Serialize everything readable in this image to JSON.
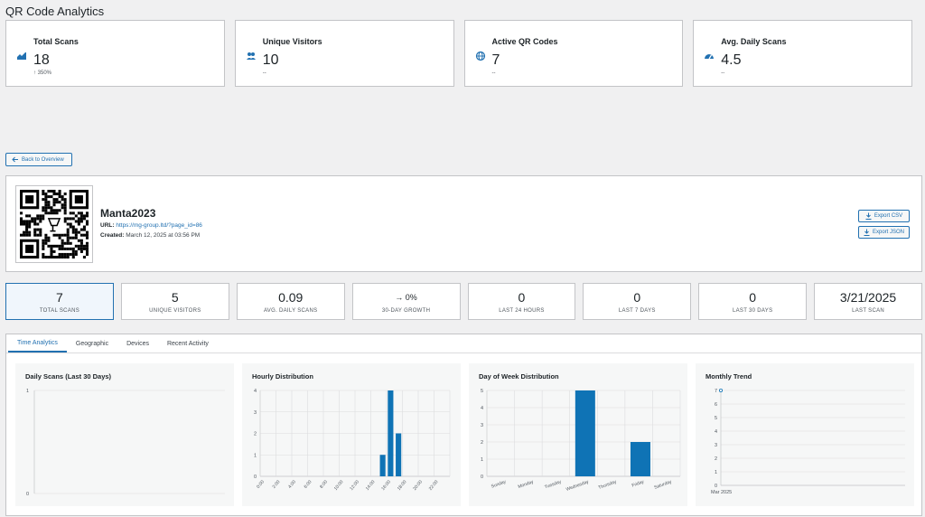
{
  "page": {
    "title": "QR Code Analytics"
  },
  "summary_cards": [
    {
      "label": "Total Scans",
      "value": "18",
      "sub": "↑ 350%",
      "icon": "chart-area-icon"
    },
    {
      "label": "Unique Visitors",
      "value": "10",
      "sub": "--",
      "icon": "users-icon"
    },
    {
      "label": "Active QR Codes",
      "value": "7",
      "sub": "--",
      "icon": "globe-icon"
    },
    {
      "label": "Avg. Daily Scans",
      "value": "4.5",
      "sub": "--",
      "icon": "dashboard-icon"
    }
  ],
  "back_button": {
    "label": "Back to Overview"
  },
  "qr": {
    "name": "Manta2023",
    "url_label": "URL:",
    "url": "https://mg-group.ltd/?page_id=86",
    "created_label": "Created:",
    "created": "March 12, 2025 at 03:56 PM"
  },
  "export": {
    "csv_label": "Export CSV",
    "json_label": "Export JSON"
  },
  "stats": [
    {
      "value": "7",
      "label": "TOTAL SCANS"
    },
    {
      "value": "5",
      "label": "UNIQUE VISITORS"
    },
    {
      "value": "0.09",
      "label": "AVG. DAILY SCANS"
    },
    {
      "value": "→ 0%",
      "label": "30-DAY GROWTH"
    },
    {
      "value": "0",
      "label": "LAST 24 HOURS"
    },
    {
      "value": "0",
      "label": "LAST 7 DAYS"
    },
    {
      "value": "0",
      "label": "LAST 30 DAYS"
    },
    {
      "value": "3/21/2025",
      "label": "LAST SCAN"
    }
  ],
  "tabs": [
    {
      "label": "Time Analytics",
      "active": true
    },
    {
      "label": "Geographic",
      "active": false
    },
    {
      "label": "Devices",
      "active": false
    },
    {
      "label": "Recent Activity",
      "active": false
    }
  ],
  "colors": {
    "accent": "#2271b1",
    "bar": "#0f73b5"
  },
  "chart_data": [
    {
      "type": "line",
      "title": "Daily Scans (Last 30 Days)",
      "ylim": [
        0,
        1
      ],
      "yticks": [
        "0",
        "1"
      ],
      "x": [],
      "values": []
    },
    {
      "type": "bar",
      "title": "Hourly Distribution",
      "categories": [
        "0:00",
        "1:00",
        "2:00",
        "3:00",
        "4:00",
        "5:00",
        "6:00",
        "7:00",
        "8:00",
        "9:00",
        "10:00",
        "11:00",
        "12:00",
        "13:00",
        "14:00",
        "15:00",
        "16:00",
        "17:00",
        "18:00",
        "19:00",
        "20:00",
        "21:00",
        "22:00",
        "23:00"
      ],
      "tick_labels": [
        "0:00",
        "2:00",
        "4:00",
        "6:00",
        "8:00",
        "10:00",
        "12:00",
        "14:00",
        "16:00",
        "18:00",
        "20:00",
        "22:00"
      ],
      "values": [
        0,
        0,
        0,
        0,
        0,
        0,
        0,
        0,
        0,
        0,
        0,
        0,
        0,
        0,
        0,
        1,
        4,
        2,
        0,
        0,
        0,
        0,
        0,
        0
      ],
      "ylim": [
        0,
        4
      ],
      "yticks": [
        "0",
        "1",
        "2",
        "3",
        "4"
      ]
    },
    {
      "type": "bar",
      "title": "Day of Week Distribution",
      "categories": [
        "Sunday",
        "Monday",
        "Tuesday",
        "Wednesday",
        "Thursday",
        "Friday",
        "Saturday"
      ],
      "values": [
        0,
        0,
        0,
        5,
        0,
        2,
        0
      ],
      "ylim": [
        0,
        5
      ],
      "yticks": [
        "0",
        "1",
        "2",
        "3",
        "4",
        "5"
      ]
    },
    {
      "type": "line",
      "title": "Monthly Trend",
      "categories": [
        "Mar 2025"
      ],
      "values": [
        7
      ],
      "ylim": [
        0,
        7
      ],
      "yticks": [
        "0",
        "1",
        "2",
        "3",
        "4",
        "5",
        "6",
        "7"
      ]
    }
  ]
}
